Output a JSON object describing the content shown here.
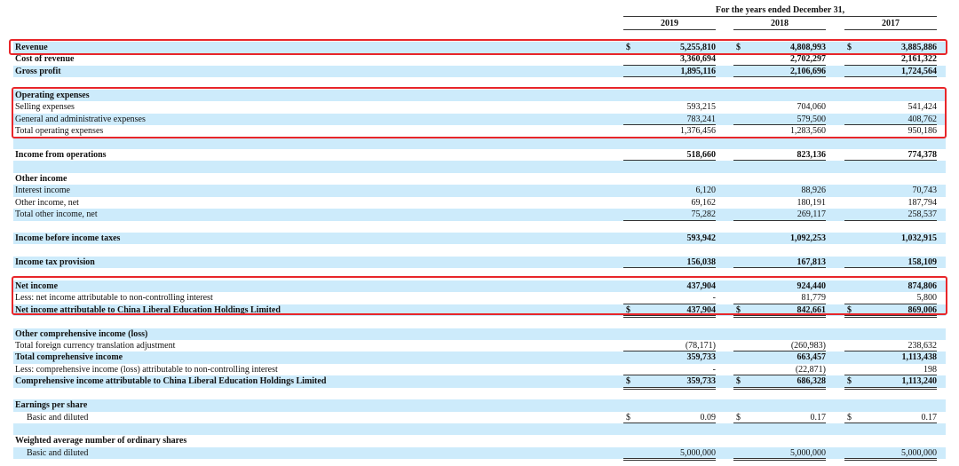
{
  "header": {
    "title": "For the years ended December 31,",
    "years": [
      "2019",
      "2018",
      "2017"
    ]
  },
  "currency_symbol": "$",
  "accent_color": "#e8262a",
  "rows": [
    {
      "label": "Revenue",
      "bold": true,
      "dollar": true,
      "values": [
        "5,255,810",
        "4,808,993",
        "3,885,886"
      ]
    },
    {
      "label": "Cost of revenue",
      "bold": true,
      "values": [
        "3,360,694",
        "2,702,297",
        "2,161,322"
      ],
      "line": "u"
    },
    {
      "label": "Gross profit",
      "bold": true,
      "values": [
        "1,895,116",
        "2,106,696",
        "1,724,564"
      ],
      "line": "u"
    },
    {
      "label": ""
    },
    {
      "label": "Operating expenses",
      "bold": true
    },
    {
      "label": "Selling expenses",
      "values": [
        "593,215",
        "704,060",
        "541,424"
      ]
    },
    {
      "label": "General and administrative expenses",
      "values": [
        "783,241",
        "579,500",
        "408,762"
      ],
      "line": "u"
    },
    {
      "label": "Total operating expenses",
      "values": [
        "1,376,456",
        "1,283,560",
        "950,186"
      ]
    },
    {
      "label": ""
    },
    {
      "label": "Income from operations",
      "bold": true,
      "values": [
        "518,660",
        "823,136",
        "774,378"
      ],
      "line": "u"
    },
    {
      "label": ""
    },
    {
      "label": "Other income",
      "bold": true
    },
    {
      "label": "Interest income",
      "values": [
        "6,120",
        "88,926",
        "70,743"
      ]
    },
    {
      "label": "Other income, net",
      "values": [
        "69,162",
        "180,191",
        "187,794"
      ]
    },
    {
      "label": "Total other income, net",
      "values": [
        "75,282",
        "269,117",
        "258,537"
      ],
      "line": "u"
    },
    {
      "label": ""
    },
    {
      "label": "Income before income taxes",
      "bold": true,
      "values": [
        "593,942",
        "1,092,253",
        "1,032,915"
      ]
    },
    {
      "label": ""
    },
    {
      "label": "Income tax provision",
      "bold": true,
      "values": [
        "156,038",
        "167,813",
        "158,109"
      ],
      "line": "u"
    },
    {
      "label": ""
    },
    {
      "label": "Net income",
      "bold": true,
      "values": [
        "437,904",
        "924,440",
        "874,806"
      ]
    },
    {
      "label": "Less: net income attributable to non-controlling interest",
      "values": [
        "-",
        "81,779",
        "5,800"
      ],
      "line": "u"
    },
    {
      "label": "Net income attributable to China Liberal Education Holdings Limited",
      "bold": true,
      "dollar": true,
      "values": [
        "437,904",
        "842,661",
        "869,006"
      ],
      "line": "uu"
    },
    {
      "label": ""
    },
    {
      "label": "Other comprehensive income (loss)",
      "bold": true
    },
    {
      "label": "Total foreign currency translation adjustment",
      "values": [
        "(78,171)",
        "(260,983)",
        "238,632"
      ],
      "line": "u"
    },
    {
      "label": "Total comprehensive income",
      "bold": true,
      "values": [
        "359,733",
        "663,457",
        "1,113,438"
      ]
    },
    {
      "label": "Less: comprehensive income (loss) attributable to non-controlling interest",
      "values": [
        "-",
        "(22,871)",
        "198"
      ],
      "line": "u"
    },
    {
      "label": "Comprehensive income attributable to China Liberal Education Holdings Limited",
      "bold": true,
      "dollar": true,
      "values": [
        "359,733",
        "686,328",
        "1,113,240"
      ],
      "line": "uu"
    },
    {
      "label": ""
    },
    {
      "label": "Earnings per share",
      "bold": true
    },
    {
      "label": "Basic and diluted",
      "indent": true,
      "dollar": true,
      "values": [
        "0.09",
        "0.17",
        "0.17"
      ],
      "line": "u"
    },
    {
      "label": ""
    },
    {
      "label": "Weighted average number of ordinary shares",
      "bold": true
    },
    {
      "label": "Basic and diluted",
      "indent": true,
      "values": [
        "5,000,000",
        "5,000,000",
        "5,000,000"
      ],
      "line": "uu"
    }
  ]
}
